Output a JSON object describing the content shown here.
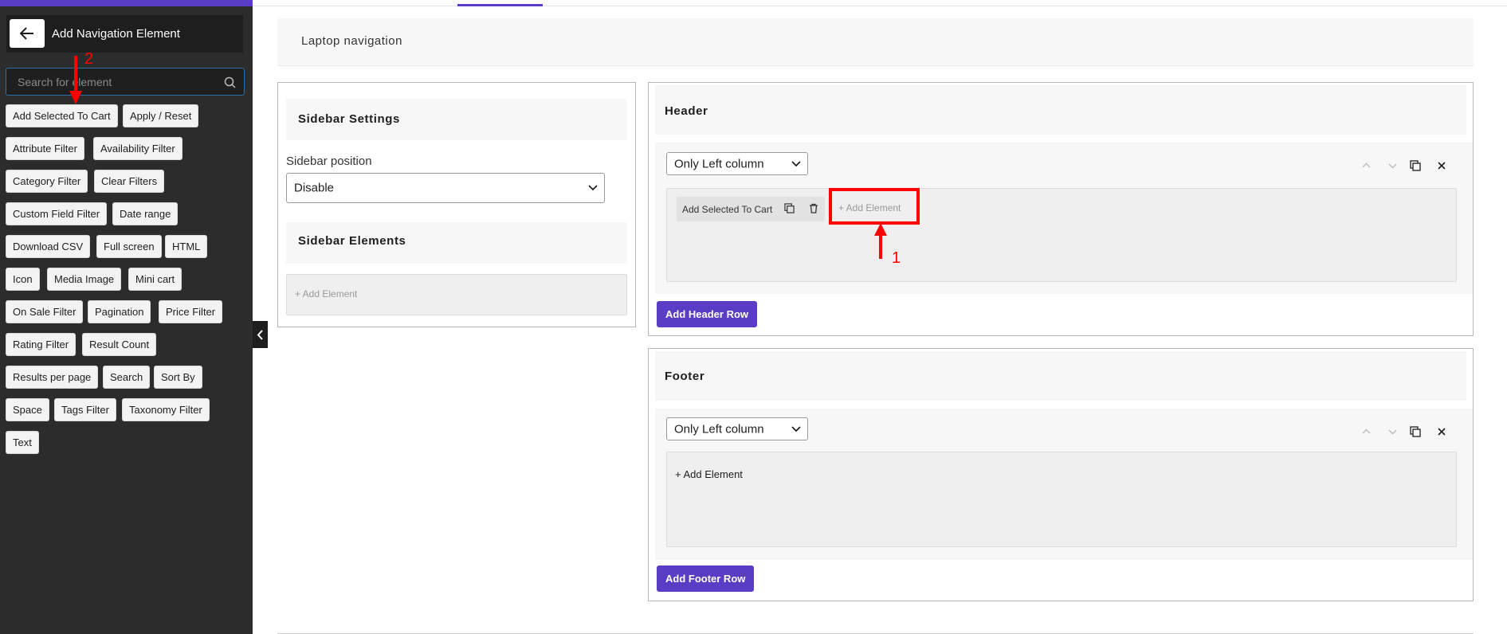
{
  "sidebar": {
    "title": "Add Navigation Element",
    "search_placeholder": "Search for element",
    "elements": [
      "Add Selected To Cart",
      "Apply / Reset",
      "Attribute Filter",
      "Availability Filter",
      "Category Filter",
      "Clear Filters",
      "Custom Field Filter",
      "Date range",
      "Download CSV",
      "Full screen",
      "HTML",
      "Icon",
      "Media Image",
      "Mini cart",
      "On Sale Filter",
      "Pagination",
      "Price Filter",
      "Rating Filter",
      "Result Count",
      "Results per page",
      "Search",
      "Sort By",
      "Space",
      "Tags Filter",
      "Taxonomy Filter",
      "Text"
    ]
  },
  "main": {
    "panel_title": "Laptop navigation",
    "sidebar_settings": {
      "title": "Sidebar Settings",
      "position_label": "Sidebar position",
      "position_value": "Disable",
      "elements_title": "Sidebar Elements",
      "add_element": "+ Add Element"
    },
    "header": {
      "title": "Header",
      "layout_value": "Only Left column",
      "row_element": "Add Selected To Cart",
      "add_element": "+ Add Element",
      "add_row_button": "Add Header Row"
    },
    "footer": {
      "title": "Footer",
      "layout_value": "Only Left column",
      "add_element": "+ Add Element",
      "add_row_button": "Add Footer Row"
    }
  },
  "annotations": {
    "label_1": "1",
    "label_2": "2",
    "color": "#ff0000"
  },
  "colors": {
    "accent": "#5b3cc4",
    "sidebar_bg": "#2c2c2c"
  }
}
